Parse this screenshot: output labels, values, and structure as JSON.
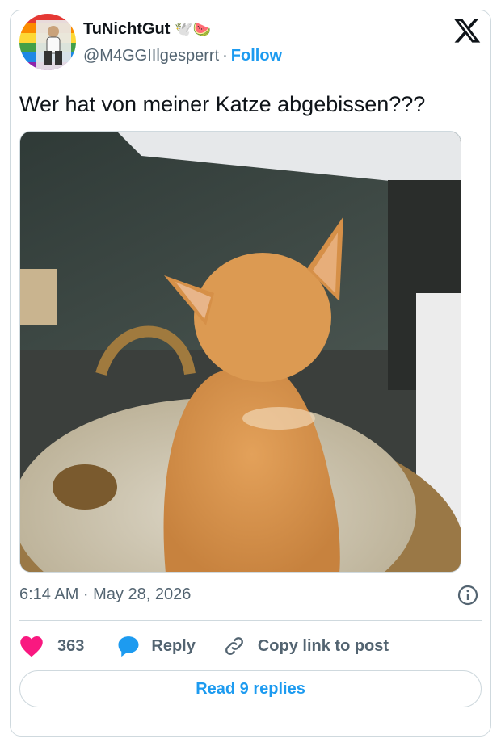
{
  "tweet": {
    "display_name": "TuNichtGut",
    "name_emojis": "🕊️🍉",
    "handle": "@M4GGIIlgesperrt",
    "separator": "·",
    "follow_label": "Follow",
    "text": "Wer hat von meiner Katze abgebissen???",
    "timestamp": "6:14 AM · May 28, 2026"
  },
  "actions": {
    "like_count": "363",
    "reply_label": "Reply",
    "copy_label": "Copy link to post",
    "read_replies_label": "Read 9 replies"
  },
  "colors": {
    "accent": "#1d9bf0",
    "like": "#f91880",
    "text_secondary": "#536471",
    "border": "#cfd9de"
  },
  "icons": {
    "logo": "x-logo-icon",
    "info": "info-icon",
    "like": "heart-icon",
    "reply": "speech-bubble-icon",
    "copy": "link-icon"
  }
}
